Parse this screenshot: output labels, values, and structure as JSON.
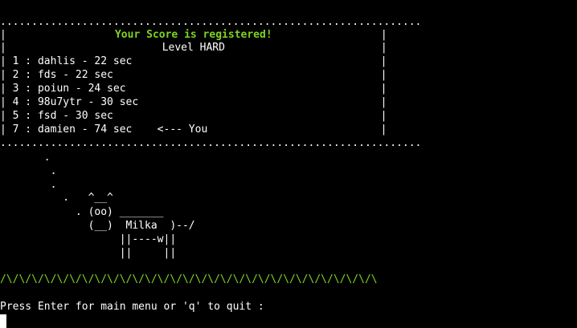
{
  "border_top": "...................................................................",
  "border_bottom": "...................................................................",
  "title": "Your Score is registered!",
  "level": "Level HARD",
  "scores": [
    "1 : dahlis - 22 sec",
    "2 : fds - 22 sec",
    "3 : poiun - 24 sec",
    "4 : 98u7ytr - 30 sec",
    "5 : fsd - 30 sec",
    "7 : damien - 74 sec    <--- You"
  ],
  "art": [
    "       .",
    "        .",
    "        .",
    "          .   ^__^",
    "            . (oo) _______",
    "              (__)  Milka  )--/",
    "                   ||----w||",
    "                   ||     ||"
  ],
  "grass": "/\\/\\/\\/\\/\\/\\/\\/\\/\\/\\/\\/\\/\\/\\/\\/\\/\\/\\/\\/\\/\\/\\/\\/\\/\\/\\/\\/\\/\\/\\",
  "prompt": "Press Enter for main menu or 'q' to quit :"
}
